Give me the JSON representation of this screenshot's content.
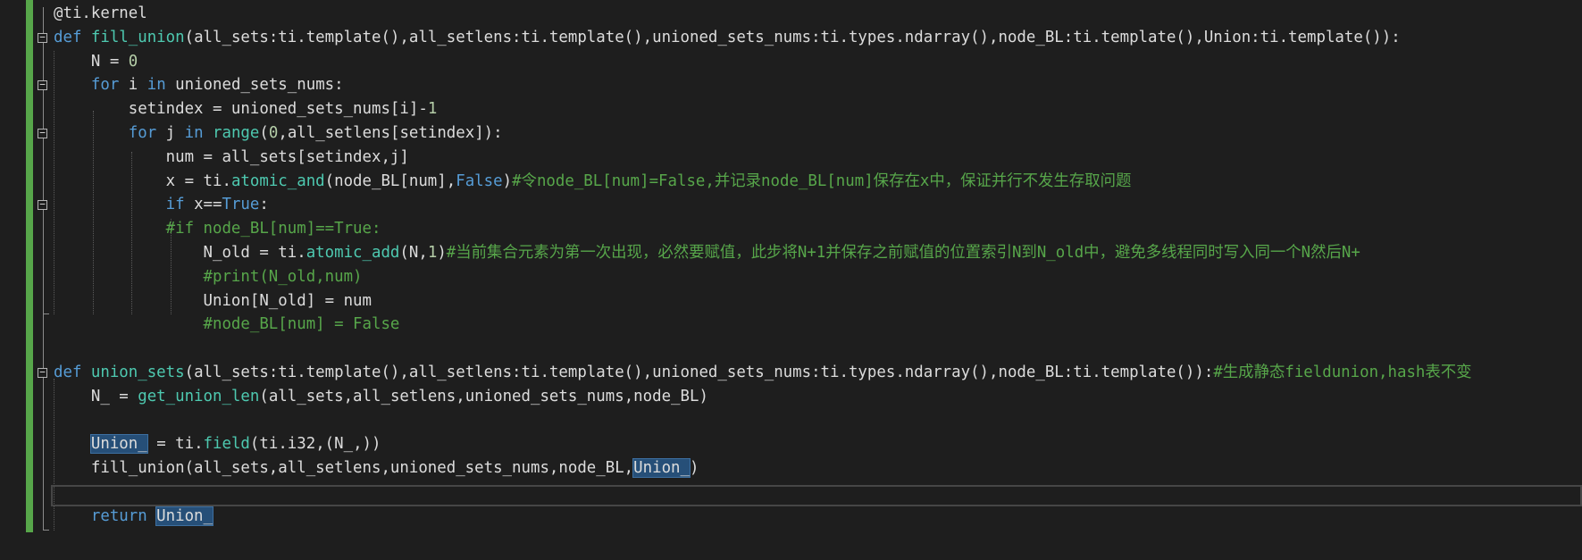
{
  "colors": {
    "background": "#1e1e1e",
    "change_bar": "#57a64a",
    "keyword": "#569cd6",
    "function": "#4ec9b0",
    "comment": "#57a64a",
    "number": "#b5cea8",
    "identifier": "#dcdcdc",
    "highlight": "#264f78"
  },
  "icons": {
    "fold": "collapse-box-icon"
  },
  "code": {
    "lines": [
      {
        "fold": false,
        "t": [
          {
            "c": "dec",
            "v": "@ti.kernel"
          }
        ]
      },
      {
        "fold": true,
        "t": [
          {
            "c": "kw",
            "v": "def "
          },
          {
            "c": "fn",
            "v": "fill_union"
          },
          {
            "c": "id",
            "v": "(all_sets:ti.template(),all_setlens:ti.template(),unioned_sets_nums:ti.types.ndarray(),node_BL:ti.template(),Union:ti.template()):"
          }
        ]
      },
      {
        "fold": false,
        "t": [
          {
            "c": "id",
            "v": "    N = "
          },
          {
            "c": "num",
            "v": "0"
          }
        ]
      },
      {
        "fold": true,
        "t": [
          {
            "c": "kw",
            "v": "    for "
          },
          {
            "c": "id",
            "v": "i "
          },
          {
            "c": "kw",
            "v": "in "
          },
          {
            "c": "id",
            "v": "unioned_sets_nums:"
          }
        ]
      },
      {
        "fold": false,
        "t": [
          {
            "c": "id",
            "v": "        setindex = unioned_sets_nums[i]-"
          },
          {
            "c": "num",
            "v": "1"
          }
        ]
      },
      {
        "fold": true,
        "t": [
          {
            "c": "kw",
            "v": "        for "
          },
          {
            "c": "id",
            "v": "j "
          },
          {
            "c": "kw",
            "v": "in "
          },
          {
            "c": "fn",
            "v": "range"
          },
          {
            "c": "id",
            "v": "("
          },
          {
            "c": "num",
            "v": "0"
          },
          {
            "c": "id",
            "v": ",all_setlens[setindex]):"
          }
        ]
      },
      {
        "fold": false,
        "t": [
          {
            "c": "id",
            "v": "            num = all_sets[setindex,j]"
          }
        ]
      },
      {
        "fold": false,
        "t": [
          {
            "c": "id",
            "v": "            x = ti."
          },
          {
            "c": "fn",
            "v": "atomic_and"
          },
          {
            "c": "id",
            "v": "(node_BL[num],"
          },
          {
            "c": "kw",
            "v": "False"
          },
          {
            "c": "id",
            "v": ")"
          },
          {
            "c": "cm",
            "v": "#令node_BL[num]=False,并记录node_BL[num]保存在x中，保证并行不发生存取问题"
          }
        ]
      },
      {
        "fold": true,
        "t": [
          {
            "c": "kw",
            "v": "            if "
          },
          {
            "c": "id",
            "v": "x=="
          },
          {
            "c": "kw",
            "v": "True"
          },
          {
            "c": "id",
            "v": ":"
          }
        ]
      },
      {
        "fold": false,
        "t": [
          {
            "c": "cm",
            "v": "            #if node_BL[num]==True:"
          }
        ]
      },
      {
        "fold": false,
        "t": [
          {
            "c": "id",
            "v": "                N_old = ti."
          },
          {
            "c": "fn",
            "v": "atomic_add"
          },
          {
            "c": "id",
            "v": "(N,"
          },
          {
            "c": "num",
            "v": "1"
          },
          {
            "c": "id",
            "v": ")"
          },
          {
            "c": "cm",
            "v": "#当前集合元素为第一次出现，必然要赋值，此步将N+1并保存之前赋值的位置索引N到N_old中，避免多线程同时写入同一个N然后N+"
          }
        ]
      },
      {
        "fold": false,
        "t": [
          {
            "c": "cm",
            "v": "                #print(N_old,num)"
          }
        ]
      },
      {
        "fold": false,
        "t": [
          {
            "c": "id",
            "v": "                Union[N_old] = num"
          }
        ]
      },
      {
        "fold": false,
        "t": [
          {
            "c": "cm",
            "v": "                #node_BL[num] = False"
          }
        ]
      },
      {
        "fold": false,
        "t": []
      },
      {
        "fold": true,
        "t": [
          {
            "c": "kw",
            "v": "def "
          },
          {
            "c": "fn",
            "v": "union_sets"
          },
          {
            "c": "id",
            "v": "(all_sets:ti.template(),all_setlens:ti.template(),unioned_sets_nums:ti.types.ndarray(),node_BL:ti.template()):"
          },
          {
            "c": "cm",
            "v": "#生成静态fieldunion,hash表不变"
          }
        ]
      },
      {
        "fold": false,
        "t": [
          {
            "c": "id",
            "v": "    N_ = "
          },
          {
            "c": "fn",
            "v": "get_union_len"
          },
          {
            "c": "id",
            "v": "(all_sets,all_setlens,unioned_sets_nums,node_BL)"
          }
        ]
      },
      {
        "fold": false,
        "t": []
      },
      {
        "fold": false,
        "t": [
          {
            "c": "id",
            "v": "    "
          },
          {
            "c": "id hl",
            "v": "Union_"
          },
          {
            "c": "id",
            "v": " = ti."
          },
          {
            "c": "fn",
            "v": "field"
          },
          {
            "c": "id",
            "v": "(ti.i32,(N_,))"
          }
        ]
      },
      {
        "fold": false,
        "t": [
          {
            "c": "id",
            "v": "    fill_union(all_sets,all_setlens,unioned_sets_nums,node_BL,"
          },
          {
            "c": "id hl",
            "v": "Union_"
          },
          {
            "c": "id",
            "v": ")"
          }
        ]
      },
      {
        "fold": false,
        "t": []
      },
      {
        "fold": false,
        "t": [
          {
            "c": "kw",
            "v": "    return "
          },
          {
            "c": "id hl",
            "v": "Union_"
          }
        ]
      }
    ]
  }
}
